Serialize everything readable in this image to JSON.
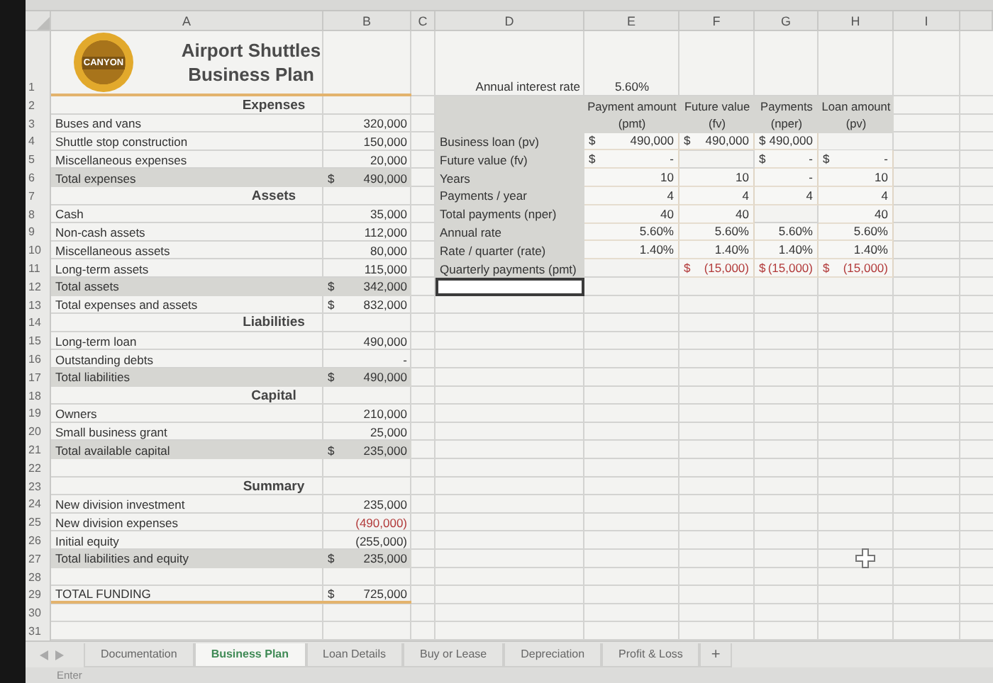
{
  "column_headers": [
    "A",
    "B",
    "C",
    "D",
    "E",
    "F",
    "G",
    "H",
    "I"
  ],
  "logo": {
    "text": "CANYON"
  },
  "title_lines": [
    "Airport Shuttles",
    "Business Plan"
  ],
  "plan_rows": [
    {
      "number": "1",
      "kind": "title"
    },
    {
      "number": "2",
      "kind": "section",
      "label": "Expenses"
    },
    {
      "number": "3",
      "kind": "item",
      "label": "Buses and vans",
      "value": "320,000"
    },
    {
      "number": "4",
      "kind": "item",
      "label": "Shuttle stop construction",
      "value": "150,000"
    },
    {
      "number": "5",
      "kind": "item",
      "label": "Miscellaneous expenses",
      "value": "20,000"
    },
    {
      "number": "6",
      "kind": "total",
      "label": "Total expenses",
      "currency": "$",
      "value": "490,000"
    },
    {
      "number": "7",
      "kind": "section",
      "label": "Assets"
    },
    {
      "number": "8",
      "kind": "item",
      "label": "Cash",
      "value": "35,000"
    },
    {
      "number": "9",
      "kind": "item",
      "label": "Non-cash assets",
      "value": "112,000"
    },
    {
      "number": "10",
      "kind": "item",
      "label": "Miscellaneous assets",
      "value": "80,000"
    },
    {
      "number": "11",
      "kind": "item",
      "label": "Long-term assets",
      "value": "115,000"
    },
    {
      "number": "12",
      "kind": "total",
      "label": "Total assets",
      "currency": "$",
      "value": "342,000"
    },
    {
      "number": "13",
      "kind": "item",
      "label": "Total expenses and assets",
      "currency": "$",
      "value": "832,000"
    },
    {
      "number": "14",
      "kind": "section",
      "label": "Liabilities"
    },
    {
      "number": "15",
      "kind": "item",
      "label": "Long-term loan",
      "value": "490,000"
    },
    {
      "number": "16",
      "kind": "item",
      "label": "Outstanding debts",
      "value": "-"
    },
    {
      "number": "17",
      "kind": "total",
      "label": "Total liabilities",
      "currency": "$",
      "value": "490,000"
    },
    {
      "number": "18",
      "kind": "section",
      "label": "Capital"
    },
    {
      "number": "19",
      "kind": "item",
      "label": "Owners",
      "value": "210,000"
    },
    {
      "number": "20",
      "kind": "item",
      "label": "Small business grant",
      "value": "25,000"
    },
    {
      "number": "21",
      "kind": "total",
      "label": "Total available capital",
      "currency": "$",
      "value": "235,000"
    },
    {
      "number": "22",
      "kind": "blank"
    },
    {
      "number": "23",
      "kind": "section",
      "label": "Summary"
    },
    {
      "number": "24",
      "kind": "item",
      "label": "New division investment",
      "value": "235,000"
    },
    {
      "number": "25",
      "kind": "item",
      "label": "New division expenses",
      "value": "(490,000)",
      "negative": true
    },
    {
      "number": "26",
      "kind": "item",
      "label": "Initial equity",
      "value": "(255,000)",
      "negative": false
    },
    {
      "number": "27",
      "kind": "total",
      "label": "Total liabilities and equity",
      "currency": "$",
      "value": "235,000"
    },
    {
      "number": "28",
      "kind": "blank"
    },
    {
      "number": "29",
      "kind": "grand_total",
      "label": "TOTAL FUNDING",
      "currency": "$",
      "value": "725,000"
    },
    {
      "number": "30",
      "kind": "blank"
    },
    {
      "number": "31",
      "kind": "blank"
    }
  ],
  "loan_table": {
    "rate_label": "Annual interest rate",
    "rate": "5.60%",
    "columns": [
      {
        "heading": "Payment amount",
        "subheading": "(pmt)"
      },
      {
        "heading": "Future value",
        "subheading": "(fv)"
      },
      {
        "heading": "Payments",
        "subheading": "(nper)"
      },
      {
        "heading": "Loan amount",
        "subheading": "(pv)"
      }
    ],
    "rows": [
      {
        "label": "Business loan (pv)",
        "cells": [
          {
            "currency": "$",
            "value": "490,000"
          },
          {
            "currency": "$",
            "value": "490,000"
          },
          {
            "currency": "$",
            "value": "490,000"
          },
          null
        ]
      },
      {
        "label": "Future value (fv)",
        "cells": [
          {
            "currency": "$",
            "value": "-"
          },
          null,
          {
            "currency": "$",
            "value": "-"
          },
          {
            "currency": "$",
            "value": "-"
          }
        ]
      },
      {
        "label": "Years",
        "cells": [
          {
            "value": "10"
          },
          {
            "value": "10"
          },
          {
            "value": "-"
          },
          {
            "value": "10"
          }
        ]
      },
      {
        "label": "Payments / year",
        "cells": [
          {
            "value": "4"
          },
          {
            "value": "4"
          },
          {
            "value": "4"
          },
          {
            "value": "4"
          }
        ]
      },
      {
        "label": "Total payments (nper)",
        "cells": [
          {
            "value": "40"
          },
          {
            "value": "40"
          },
          null,
          {
            "value": "40"
          }
        ]
      },
      {
        "label": "Annual rate",
        "cells": [
          {
            "value": "5.60%"
          },
          {
            "value": "5.60%"
          },
          {
            "value": "5.60%"
          },
          {
            "value": "5.60%"
          }
        ]
      },
      {
        "label": "Rate / quarter (rate)",
        "cells": [
          {
            "value": "1.40%"
          },
          {
            "value": "1.40%"
          },
          {
            "value": "1.40%"
          },
          {
            "value": "1.40%"
          }
        ]
      },
      {
        "label": "Quarterly payments (pmt)",
        "cells": [
          null,
          {
            "currency": "$",
            "value": "(15,000)",
            "negative": true
          },
          {
            "currency": "$",
            "value": "(15,000)",
            "negative": true
          },
          {
            "currency": "$",
            "value": "(15,000)",
            "negative": true
          }
        ]
      }
    ],
    "active_cell": {
      "selected": true
    }
  },
  "tabs": [
    {
      "label": "Documentation",
      "selected": false
    },
    {
      "label": "Business Plan",
      "selected": true
    },
    {
      "label": "Loan Details",
      "selected": false
    },
    {
      "label": "Buy or Lease",
      "selected": false
    },
    {
      "label": "Depreciation",
      "selected": false
    },
    {
      "label": "Profit & Loss",
      "selected": false
    }
  ],
  "add_sheet": "+",
  "status_bar": "Enter"
}
